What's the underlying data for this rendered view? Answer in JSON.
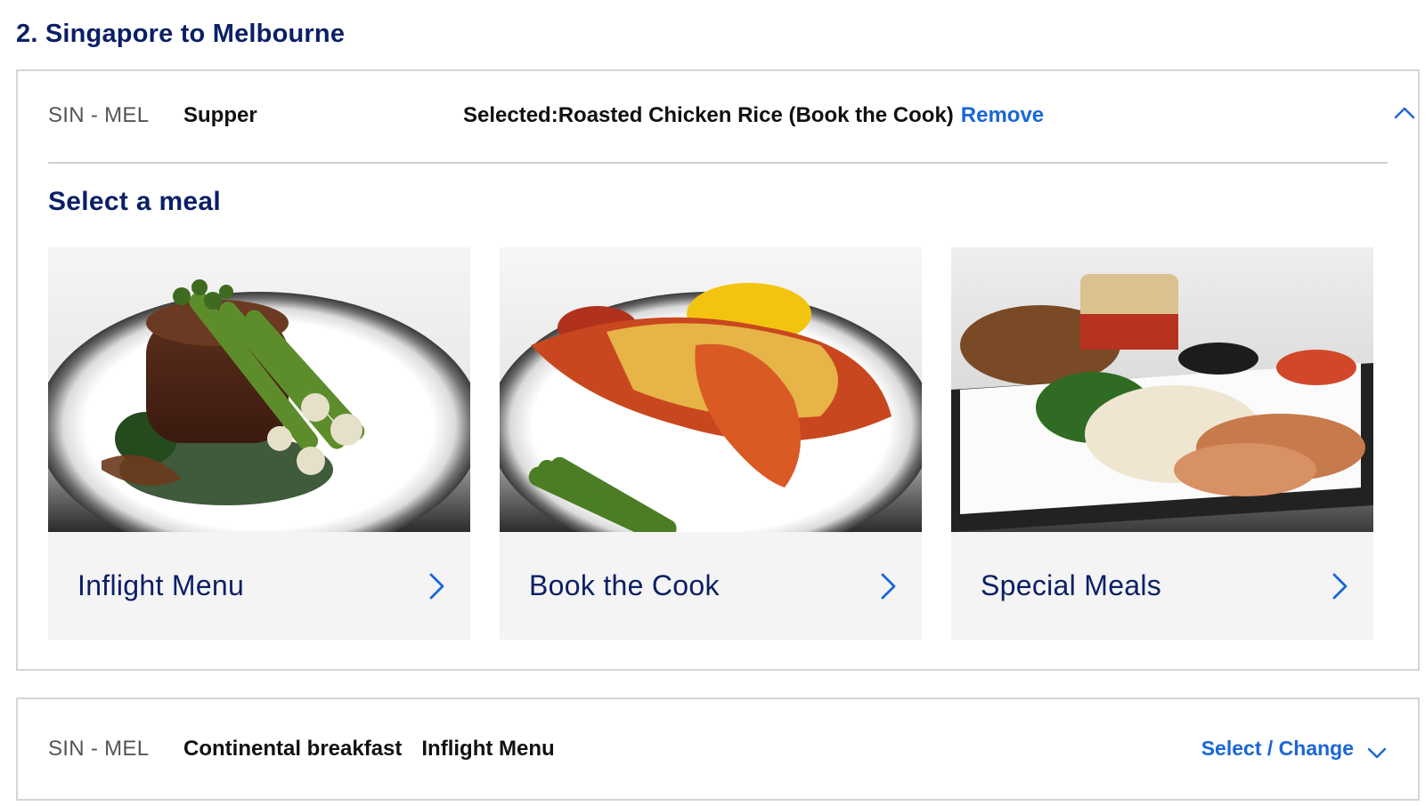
{
  "route": {
    "title": "2. Singapore to Melbourne"
  },
  "segments": [
    {
      "sector": "SIN - MEL",
      "meal_time": "Supper",
      "selected_text": "Selected:Roasted Chicken Rice (Book the Cook)",
      "remove_label": "Remove",
      "expanded": true
    },
    {
      "sector": "SIN - MEL",
      "meal_time": "Continental breakfast",
      "menu_type": "Inflight Menu",
      "select_change_label": "Select / Change",
      "expanded": false
    }
  ],
  "select_meal": {
    "title": "Select a meal",
    "cards": [
      {
        "label": "Inflight Menu",
        "image": "steak-asparagus-plate",
        "icon": "chevron-right-icon"
      },
      {
        "label": "Book the Cook",
        "image": "lobster-thermidor-plate",
        "icon": "chevron-right-icon"
      },
      {
        "label": "Special Meals",
        "image": "chicken-rice-tray",
        "icon": "chevron-right-icon"
      }
    ]
  },
  "colors": {
    "heading_navy": "#0b1f66",
    "link_blue": "#1a66d9",
    "border_grey": "#d4d4d4",
    "card_bg": "#f4f4f4"
  }
}
